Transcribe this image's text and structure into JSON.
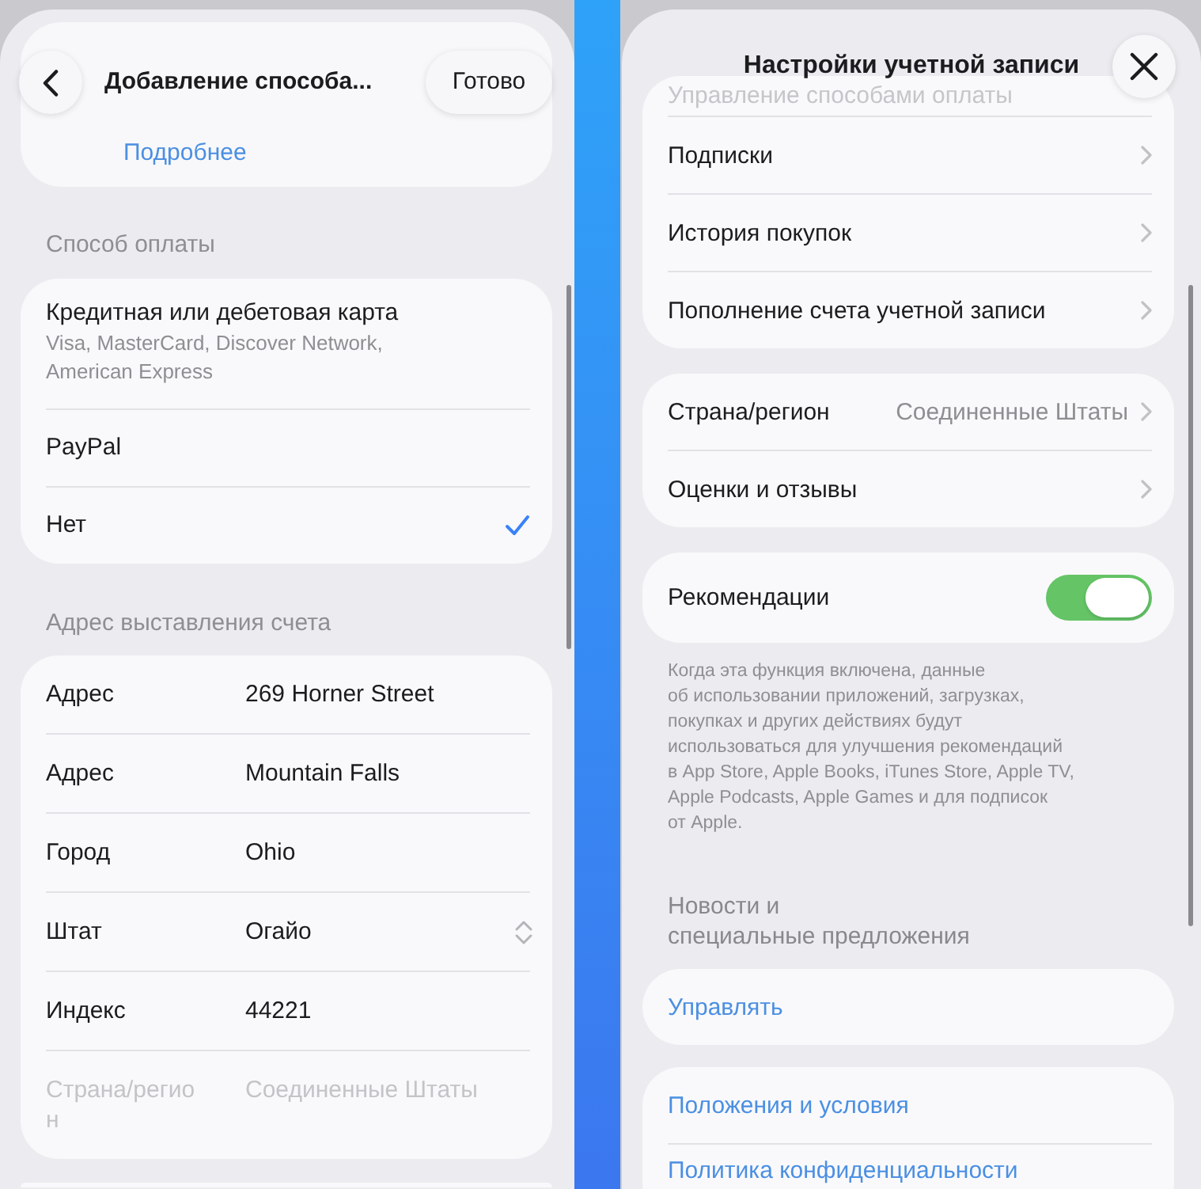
{
  "left_screen": {
    "title": "Добавление способа...",
    "done_button": "Готово",
    "info_link": "Подробнее",
    "payment_section": {
      "title": "Способ оплаты",
      "options": [
        {
          "label": "Кредитная или дебетовая карта",
          "detail": "Visa, MasterCard, Discover Network, American Express",
          "selected": false
        },
        {
          "label": "PayPal",
          "selected": false
        },
        {
          "label": "Нет",
          "selected": true
        }
      ]
    },
    "billing_section": {
      "title": "Адрес выставления счета",
      "fields": [
        {
          "label": "Адрес",
          "value": "269 Horner Street",
          "kind": "text",
          "disabled": false
        },
        {
          "label": "Адрес",
          "value": "Mountain Falls",
          "kind": "text",
          "disabled": false
        },
        {
          "label": "Город",
          "value": "Ohio",
          "kind": "text",
          "disabled": false
        },
        {
          "label": "Штат",
          "value": "Огайо",
          "kind": "picker",
          "disabled": false
        },
        {
          "label": "Индекс",
          "value": "44221",
          "kind": "text",
          "disabled": false
        },
        {
          "label": "Страна/регион",
          "value": "Соединенные Штаты",
          "kind": "text",
          "disabled": true
        }
      ]
    }
  },
  "right_screen": {
    "title": "Настройки учетной записи",
    "groups": [
      {
        "rows": [
          {
            "kind": "faded",
            "label": "Управление способами оплаты"
          },
          {
            "kind": "nav",
            "label": "Подписки"
          },
          {
            "kind": "nav",
            "label": "История покупок"
          },
          {
            "kind": "nav",
            "label": "Пополнение счета учетной записи"
          }
        ]
      },
      {
        "rows": [
          {
            "kind": "nav",
            "label": "Страна/регион",
            "value": "Соединенные Штаты"
          },
          {
            "kind": "nav",
            "label": "Оценки и отзывы"
          }
        ]
      },
      {
        "rows": [
          {
            "kind": "toggle",
            "label": "Рекомендации",
            "on": true
          }
        ],
        "footnote": "Когда эта функция включена, данные\nоб использовании приложений, загрузках,\nпокупках и других действиях будут\nиспользоваться для улучшения рекомендаций\nв App Store, Apple Books, iTunes Store, Apple TV,\nApple Podcasts, Apple Games и для подписок\nот Apple."
      },
      {
        "header": "Новости и\nспециальные предложения",
        "rows": [
          {
            "kind": "action",
            "label": "Управлять"
          }
        ]
      },
      {
        "rows": [
          {
            "kind": "action",
            "label": "Положения и условия"
          },
          {
            "kind": "action",
            "label": "Политика конфиденциальности"
          }
        ]
      }
    ]
  }
}
